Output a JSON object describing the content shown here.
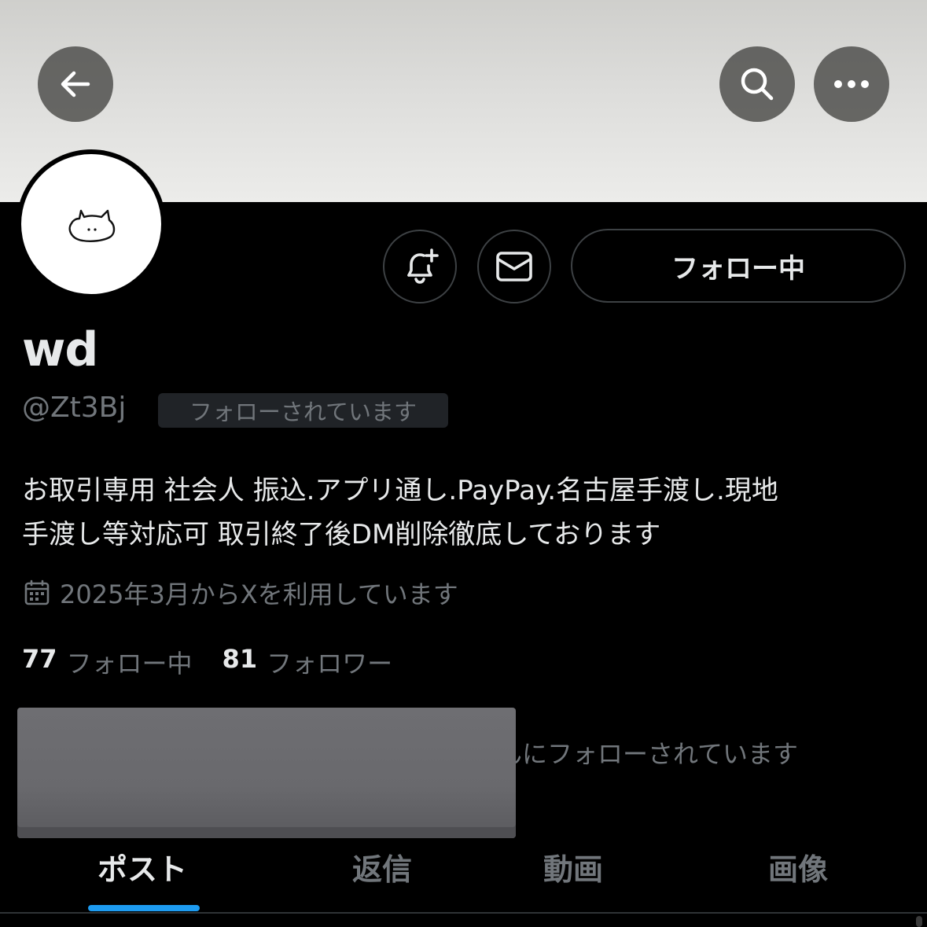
{
  "header": {
    "back_icon": "arrow-left-icon",
    "search_icon": "search-icon",
    "more_icon": "more-horizontal-icon"
  },
  "profile": {
    "name": "wd",
    "handle": "@Zt3Bj",
    "follows_you_badge": "フォローされています",
    "bio_line1": "お取引専用 社会人 振込.アプリ通し.PayPay.名古屋手渡し.現地",
    "bio_line2": "手渡し等対応可 取引終了後DM削除徹底しております",
    "joined": "2025年3月からXを利用しています",
    "following_count": "77",
    "following_label": "フォロー中",
    "followers_count": "81",
    "followers_label": "フォロワー",
    "followed_by_text": "んにフォローされています"
  },
  "actions": {
    "notify_icon": "bell-plus-icon",
    "message_icon": "mail-icon",
    "follow_label": "フォロー中"
  },
  "tabs": [
    {
      "label": "ポスト",
      "active": true
    },
    {
      "label": "返信",
      "active": false
    },
    {
      "label": "動画",
      "active": false
    },
    {
      "label": "画像",
      "active": false
    }
  ],
  "colors": {
    "background": "#000000",
    "text_primary": "#e7e9ea",
    "text_secondary": "#71767b",
    "accent": "#1d9bf0",
    "border": "#3d4144"
  }
}
